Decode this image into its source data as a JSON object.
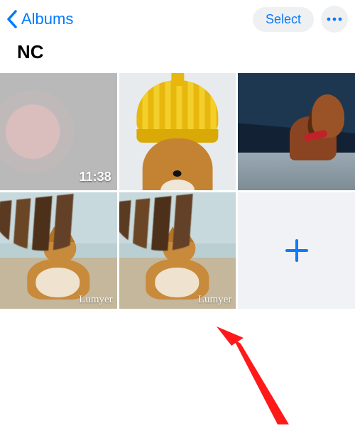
{
  "nav": {
    "back_label": "Albums",
    "select_label": "Select"
  },
  "album": {
    "title": "NC"
  },
  "tiles": [
    {
      "kind": "video",
      "duration": "11:38"
    },
    {
      "kind": "photo"
    },
    {
      "kind": "photo"
    },
    {
      "kind": "photo",
      "watermark": "Lumyer"
    },
    {
      "kind": "photo",
      "watermark": "Lumyer"
    },
    {
      "kind": "add"
    }
  ]
}
